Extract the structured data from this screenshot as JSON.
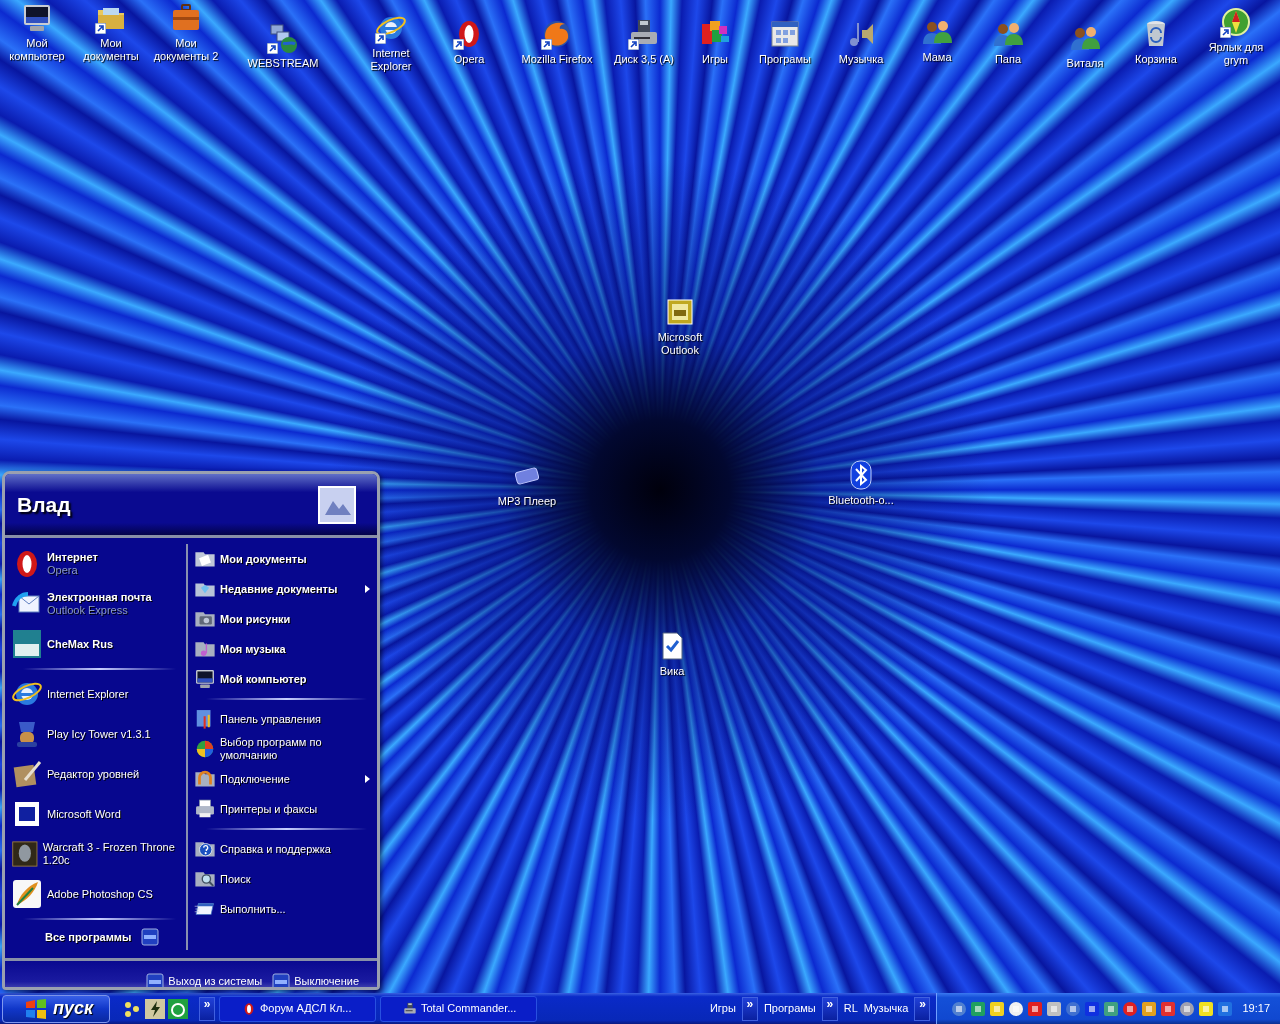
{
  "desktop_icons": [
    {
      "label": "Мой компьютер",
      "kind": "monitor",
      "shortcut": false
    },
    {
      "label": "Мои документы",
      "kind": "folder",
      "shortcut": true
    },
    {
      "label": "Мои документы 2",
      "kind": "briefcase",
      "shortcut": false
    },
    {
      "label": "WEBSTREAM",
      "kind": "network",
      "shortcut": true
    },
    {
      "label": "Internet Explorer",
      "kind": "ie",
      "shortcut": true
    },
    {
      "label": "Opera",
      "kind": "opera",
      "shortcut": true
    },
    {
      "label": "Mozilla Firefox",
      "kind": "firefox",
      "shortcut": true
    },
    {
      "label": "Диск 3,5 (A)",
      "kind": "floppy",
      "shortcut": true
    },
    {
      "label": "Игры",
      "kind": "games",
      "shortcut": false
    },
    {
      "label": "Програмы",
      "kind": "programs",
      "shortcut": false
    },
    {
      "label": "Музычка",
      "kind": "music",
      "shortcut": false
    },
    {
      "label": "Мама",
      "kind": "users",
      "shortcut": false
    },
    {
      "label": "Папа",
      "kind": "users",
      "shortcut": false
    },
    {
      "label": "Виталя",
      "kind": "users",
      "shortcut": false
    },
    {
      "label": "Корзина",
      "kind": "bin",
      "shortcut": false
    },
    {
      "label": "Ярлык для grym",
      "kind": "grym",
      "shortcut": true
    },
    {
      "label": "Microsoft Outlook",
      "kind": "outlook",
      "shortcut": false
    },
    {
      "label": "MP3 Плеер",
      "kind": "player",
      "shortcut": false
    },
    {
      "label": "Bluetooth-o...",
      "kind": "bluetooth",
      "shortcut": false
    },
    {
      "label": "Вика",
      "kind": "document",
      "shortcut": false
    }
  ],
  "start_menu": {
    "user": "Влад",
    "pinned": [
      {
        "title": "Интернет",
        "subtitle": "Opera",
        "kind": "opera"
      },
      {
        "title": "Электронная почта",
        "subtitle": "Outlook Express",
        "kind": "mail"
      },
      {
        "title": "CheMax Rus",
        "kind": "chemax"
      }
    ],
    "recent": [
      {
        "title": "Internet Explorer",
        "kind": "ie"
      },
      {
        "title": "Play Icy Tower v1.3.1",
        "kind": "tower"
      },
      {
        "title": "Редактор уровней",
        "kind": "scroll"
      },
      {
        "title": "Microsoft Word",
        "kind": "word"
      },
      {
        "title": "Warcraft 3 - Frozen Throne 1.20c",
        "kind": "warcraft"
      },
      {
        "title": "Adobe Photoshop CS",
        "kind": "photoshop"
      }
    ],
    "all_programs": "Все программы",
    "place_groups": [
      {
        "bold": true,
        "items": [
          {
            "label": "Мои документы",
            "kind": "docfolder",
            "submenu": false
          },
          {
            "label": "Недавние документы",
            "kind": "recentfolder",
            "submenu": true
          },
          {
            "label": "Мои рисунки",
            "kind": "camera",
            "submenu": false
          },
          {
            "label": "Моя музыка",
            "kind": "musicfolder",
            "submenu": false
          },
          {
            "label": "Мой компьютер",
            "kind": "monitor",
            "submenu": false
          }
        ]
      },
      {
        "bold": false,
        "items": [
          {
            "label": "Панель управления",
            "kind": "control",
            "submenu": false
          },
          {
            "label": "Выбор программ по умолчанию",
            "kind": "defaults",
            "submenu": false
          },
          {
            "label": "Подключение",
            "kind": "connect",
            "submenu": true
          },
          {
            "label": "Принтеры и факсы",
            "kind": "printer",
            "submenu": false
          }
        ]
      },
      {
        "bold": false,
        "items": [
          {
            "label": "Справка и поддержка",
            "kind": "help",
            "submenu": false
          },
          {
            "label": "Поиск",
            "kind": "search",
            "submenu": false
          },
          {
            "label": "Выполнить...",
            "kind": "run",
            "submenu": false
          }
        ]
      }
    ],
    "footer_buttons": [
      "Выход из системы",
      "Выключение"
    ]
  },
  "taskbar": {
    "start_label": "пуск",
    "quick_launch_more": "»",
    "tasks": [
      {
        "label": "Форум АДСЛ Кл...",
        "kind": "opera"
      },
      {
        "label": "Total Commander...",
        "kind": "floppy"
      }
    ],
    "toolbars": [
      {
        "label": "Игры",
        "chevron": "»"
      },
      {
        "label": "Програмы",
        "chevron": "»"
      },
      {
        "label": "RL"
      },
      {
        "label": "Музычка",
        "chevron": "»"
      }
    ],
    "clock": "19:17"
  }
}
